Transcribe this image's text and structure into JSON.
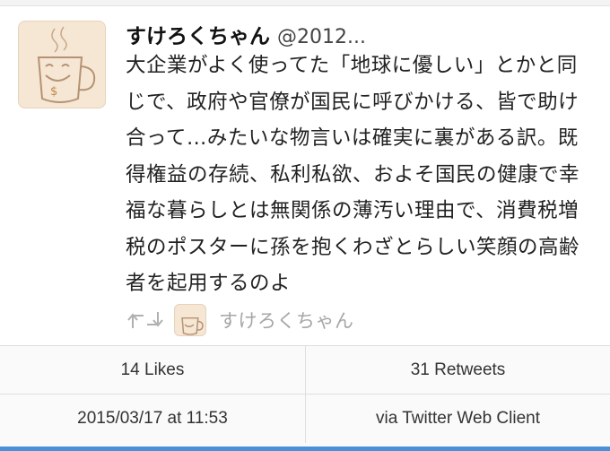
{
  "tweet": {
    "author_name": "すけろくちゃん",
    "author_handle": "@2012...",
    "text": "大企業がよく使ってた「地球に優しい」とかと同じで、政府や官僚が国民に呼びかける、皆で助け合って…みたいな物言いは確実に裏がある訳。既得権益の存続、私利私欲、およそ国民の健康で幸福な暮らしとは無関係の薄汚い理由で、消費税増税のポスターに孫を抱くわざとらしい笑顔の高齢者を起用するのよ",
    "retweeted_by": "すけろくちゃん",
    "retweet_icon": "retweet-icon",
    "avatar_icon": "coffee-cup-face-drawing"
  },
  "stats": {
    "likes": "14 Likes",
    "retweets": "31 Retweets",
    "date": "2015/03/17 at 11:53",
    "client": "via Twitter Web Client"
  },
  "colors": {
    "accent": "#4a90d9",
    "muted_text": "#a6a6a6",
    "avatar_bg": "#f6e6d4"
  }
}
